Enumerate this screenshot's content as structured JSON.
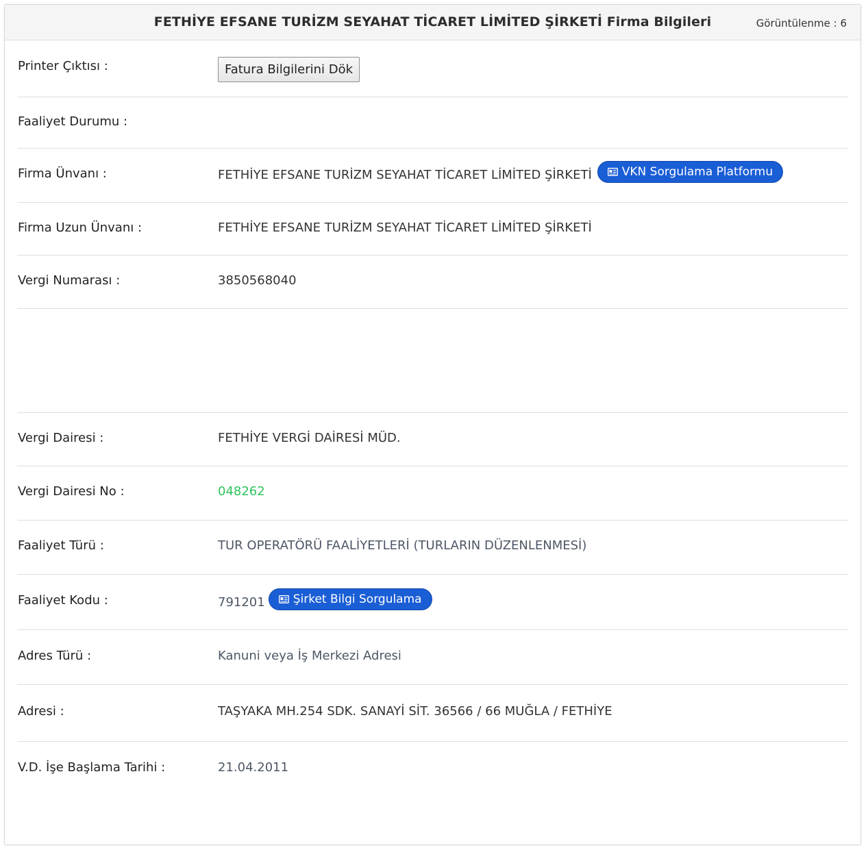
{
  "header": {
    "title": "FETHİYE EFSANE TURİZM SEYAHAT TİCARET LİMİTED ŞİRKETİ Firma Bilgileri",
    "views": "Görüntülenme : 6"
  },
  "rows": {
    "printer": {
      "label": "Printer Çıktısı :",
      "button": "Fatura Bilgilerini Dök"
    },
    "status": {
      "label": "Faaliyet Durumu :",
      "value": ""
    },
    "title": {
      "label": "Firma Ünvanı :",
      "value": "FETHİYE EFSANE TURİZM SEYAHAT TİCARET LİMİTED ŞİRKETİ",
      "button": "VKN Sorgulama Platformu"
    },
    "long_title": {
      "label": "Firma Uzun Ünvanı :",
      "value": "FETHİYE EFSANE TURİZM SEYAHAT TİCARET LİMİTED ŞİRKETİ"
    },
    "tax_number": {
      "label": "Vergi Numarası :",
      "value": "3850568040"
    },
    "tax_office": {
      "label": "Vergi Dairesi :",
      "value": "FETHİYE VERGİ DAİRESİ MÜD."
    },
    "tax_office_no": {
      "label": "Vergi Dairesi No :",
      "value": "048262"
    },
    "activity_type": {
      "label": "Faaliyet Türü :",
      "value": "TUR OPERATÖRÜ FAALİYETLERİ (TURLARIN DÜZENLENMESİ)"
    },
    "activity_code": {
      "label": "Faaliyet Kodu :",
      "value": "791201",
      "button": "Şirket Bilgi Sorgulama"
    },
    "address_type": {
      "label": "Adres Türü :",
      "value": "Kanuni veya İş Merkezi Adresi"
    },
    "address": {
      "label": "Adresi :",
      "value": "TAŞYAKA MH.254 SDK. SANAYİ SİT. 36566 / 66 MUĞLA / FETHİYE"
    },
    "start_date": {
      "label": "V.D. İşe Başlama Tarihi :",
      "value": "21.04.2011"
    }
  },
  "colors": {
    "accent": "#1a5ed6",
    "green": "#2ec45b"
  },
  "icons": {
    "pill_icon": "id-card-icon"
  }
}
